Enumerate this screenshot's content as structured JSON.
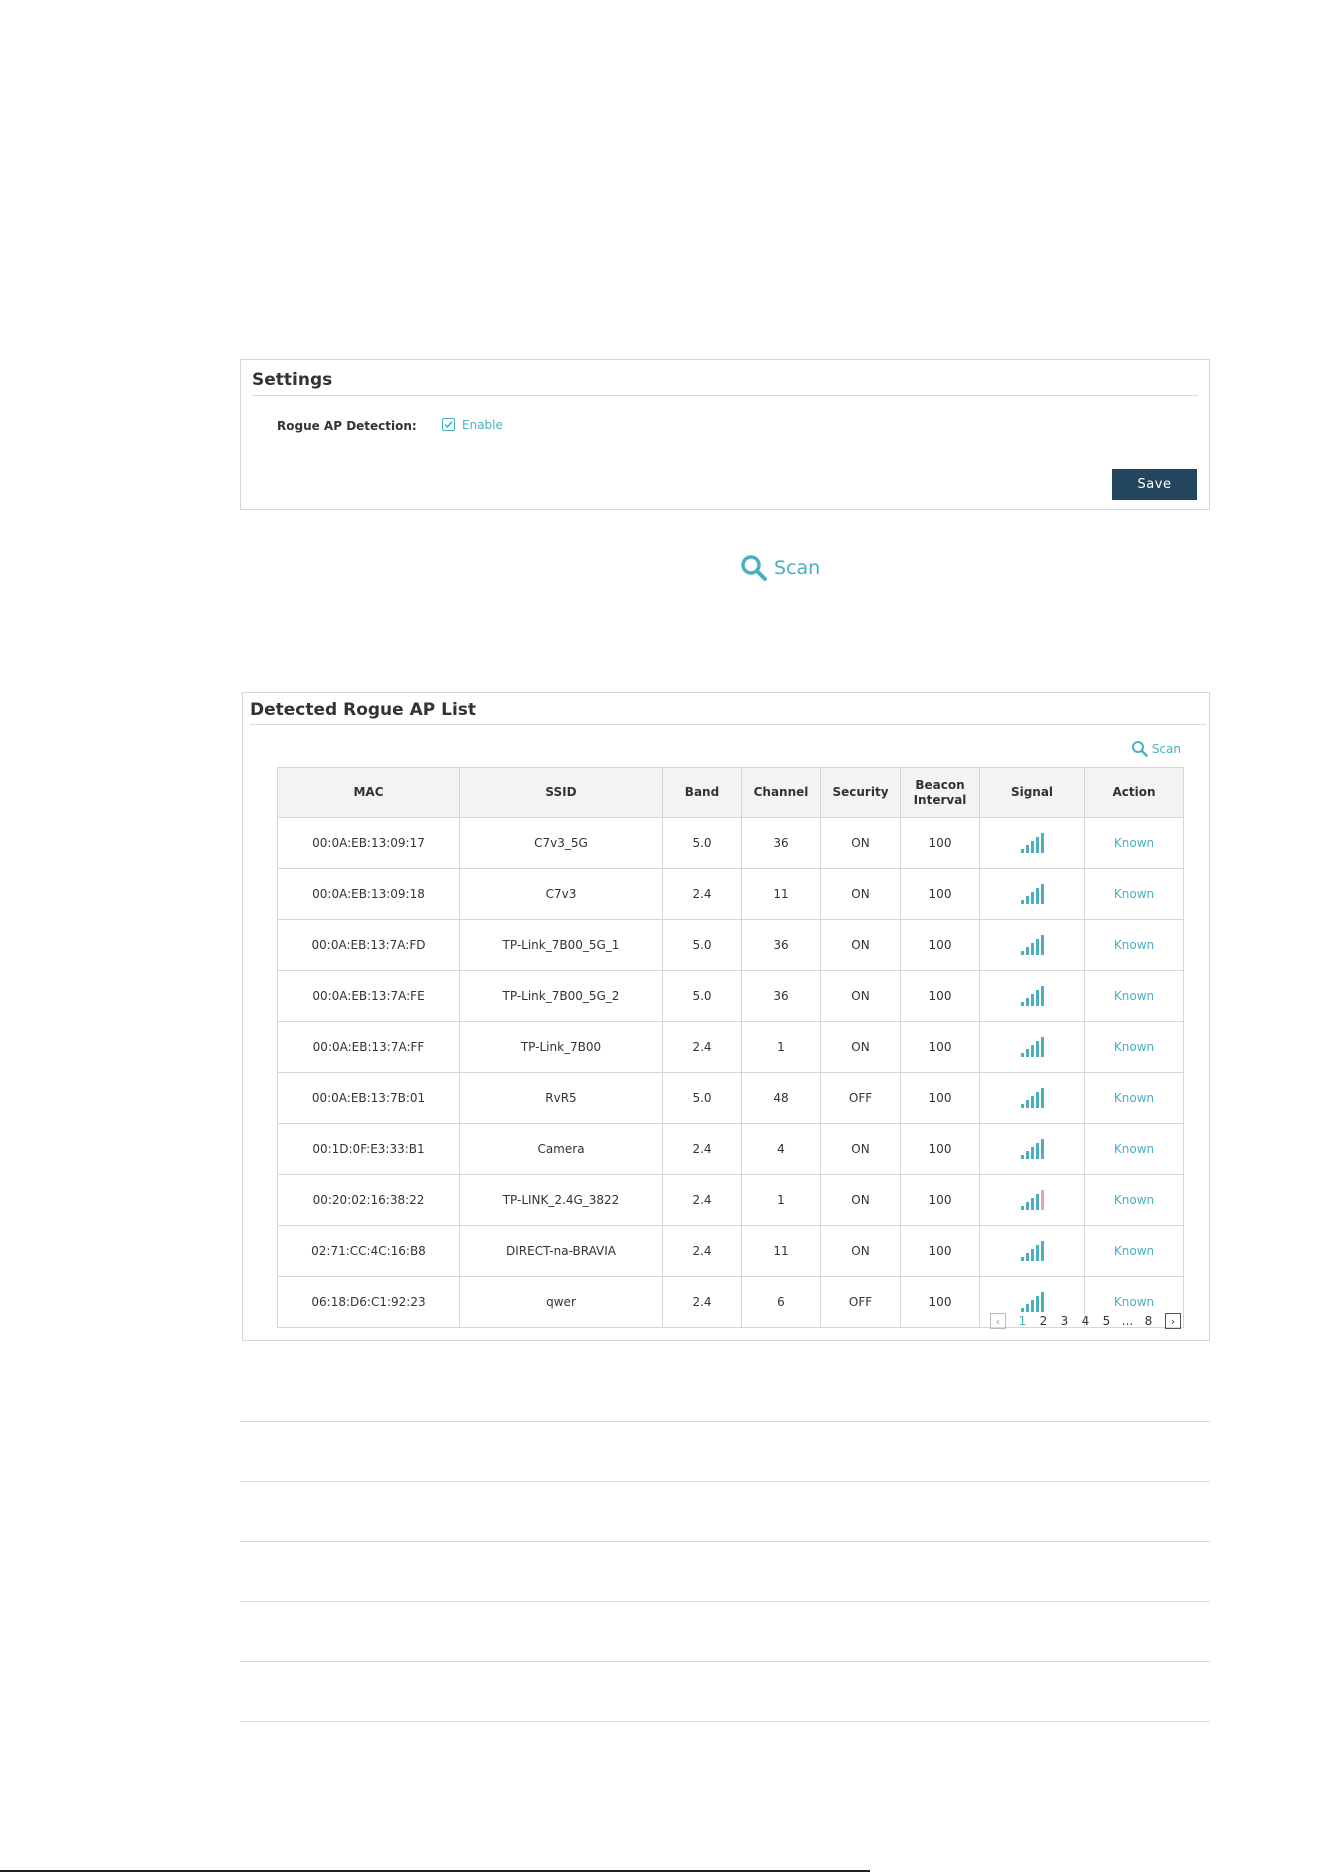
{
  "settings": {
    "title": "Settings",
    "rogue_label": "Rogue AP Detection:",
    "enable_label": "Enable",
    "enable_checked": true,
    "save_label": "Save"
  },
  "scan_large": {
    "label": "Scan",
    "icon": "search-icon"
  },
  "ap_list": {
    "title": "Detected Rogue AP List",
    "scan_label": "Scan",
    "columns": [
      "MAC",
      "SSID",
      "Band",
      "Channel",
      "Security",
      "Beacon Interval",
      "Signal",
      "Action"
    ],
    "rows": [
      {
        "mac": "00:0A:EB:13:09:17",
        "ssid": "C7v3_5G",
        "band": "5.0",
        "channel": "36",
        "security": "ON",
        "beacon": "100",
        "signal_bars": 5,
        "signal_color": "#4ab0c1",
        "action": "Known"
      },
      {
        "mac": "00:0A:EB:13:09:18",
        "ssid": "C7v3",
        "band": "2.4",
        "channel": "11",
        "security": "ON",
        "beacon": "100",
        "signal_bars": 5,
        "signal_color": "#4ab0c1",
        "action": "Known"
      },
      {
        "mac": "00:0A:EB:13:7A:FD",
        "ssid": "TP-Link_7B00_5G_1",
        "band": "5.0",
        "channel": "36",
        "security": "ON",
        "beacon": "100",
        "signal_bars": 5,
        "signal_color": "#4ab0c1",
        "action": "Known"
      },
      {
        "mac": "00:0A:EB:13:7A:FE",
        "ssid": "TP-Link_7B00_5G_2",
        "band": "5.0",
        "channel": "36",
        "security": "ON",
        "beacon": "100",
        "signal_bars": 5,
        "signal_color": "#4ab0c1",
        "action": "Known"
      },
      {
        "mac": "00:0A:EB:13:7A:FF",
        "ssid": "TP-Link_7B00",
        "band": "2.4",
        "channel": "1",
        "security": "ON",
        "beacon": "100",
        "signal_bars": 5,
        "signal_color": "#4ab0c1",
        "action": "Known"
      },
      {
        "mac": "00:0A:EB:13:7B:01",
        "ssid": "RvR5",
        "band": "5.0",
        "channel": "48",
        "security": "OFF",
        "beacon": "100",
        "signal_bars": 5,
        "signal_color": "#4ab0c1",
        "action": "Known"
      },
      {
        "mac": "00:1D:0F:E3:33:B1",
        "ssid": "Camera",
        "band": "2.4",
        "channel": "4",
        "security": "ON",
        "beacon": "100",
        "signal_bars": 5,
        "signal_color": "#4ab0c1",
        "action": "Known"
      },
      {
        "mac": "00:20:02:16:38:22",
        "ssid": "TP-LINK_2.4G_3822",
        "band": "2.4",
        "channel": "1",
        "security": "ON",
        "beacon": "100",
        "signal_bars": 4,
        "signal_color": "#4ab0c1",
        "action": "Known"
      },
      {
        "mac": "02:71:CC:4C:16:B8",
        "ssid": "DIRECT-na-BRAVIA",
        "band": "2.4",
        "channel": "11",
        "security": "ON",
        "beacon": "100",
        "signal_bars": 5,
        "signal_color": "#4ab0c1",
        "action": "Known"
      },
      {
        "mac": "06:18:D6:C1:92:23",
        "ssid": "qwer",
        "band": "2.4",
        "channel": "6",
        "security": "OFF",
        "beacon": "100",
        "signal_bars": 5,
        "signal_color": "#4ab0c1",
        "action": "Known"
      }
    ],
    "pagination": {
      "pages": [
        "1",
        "2",
        "3",
        "4",
        "5",
        "...",
        "8"
      ],
      "current": "1",
      "prev_icon": "chevron-left-icon",
      "next_icon": "chevron-right-icon"
    }
  },
  "colors": {
    "accent": "#4ab0c1",
    "button": "#24455e",
    "border": "#d6d6d6"
  }
}
